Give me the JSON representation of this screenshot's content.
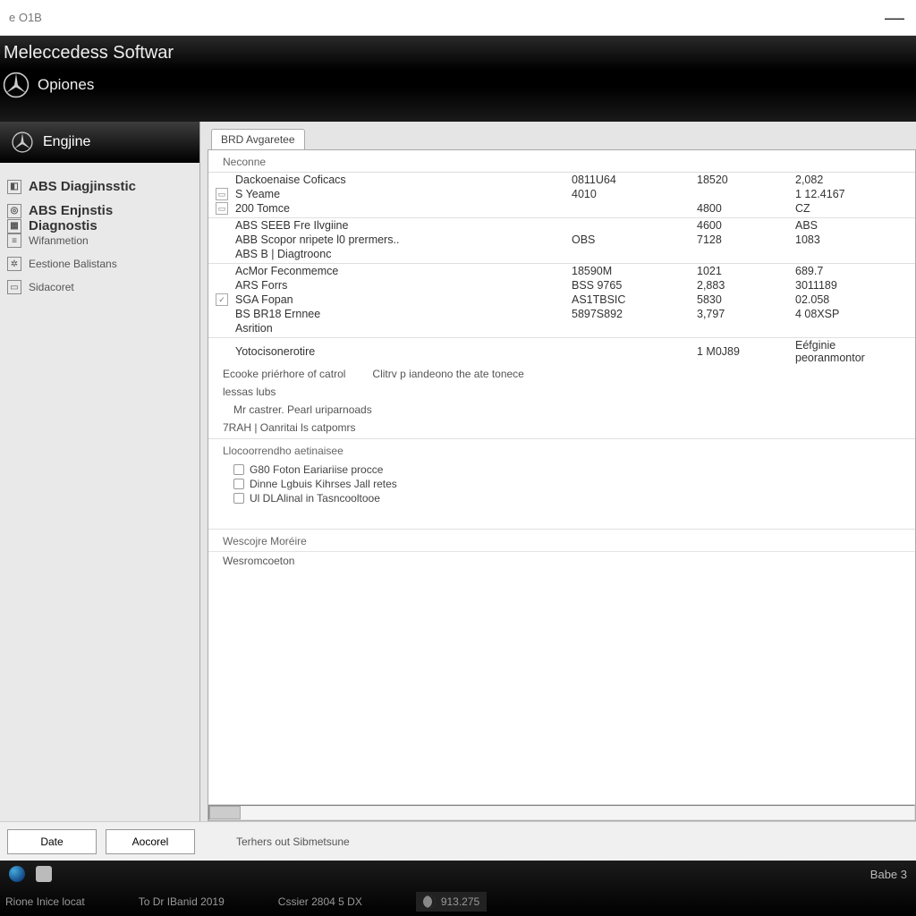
{
  "window": {
    "title_fragment": "e O1B"
  },
  "header": {
    "app_title": "Meleccedess Softwar",
    "menu_label": "Opiones"
  },
  "sidebar": {
    "active": "Engjine",
    "items": [
      {
        "label": "ABS Diagjinsstic",
        "bold": true
      },
      {
        "label": "ABS Enjnstis",
        "bold": true
      },
      {
        "label": "Diagnostis",
        "bold": true
      },
      {
        "label": "Wifanmetion",
        "small": true
      },
      {
        "label": "Eestione Balistans",
        "small": true
      },
      {
        "label": "Sidacoret",
        "small": true
      }
    ]
  },
  "content": {
    "tab_label": "BRD Avgaretee",
    "group1": {
      "header": "Neconne",
      "rows": [
        {
          "name": "Dackoenaise Coficacs",
          "c1": "0811U64",
          "c2": "18520",
          "c3": "2,082"
        },
        {
          "name": "S Yeame",
          "icon": true,
          "c1": "4010",
          "c2": "",
          "c3": "1 12.4167"
        },
        {
          "name": "200 Tomce",
          "icon": true,
          "c1": "",
          "c2": "4800",
          "c3": "CZ"
        }
      ]
    },
    "group2": {
      "rows": [
        {
          "name": "ABS SEEB Fre Ilvgiine",
          "c1": "",
          "c2": "4600",
          "c3": "ABS"
        },
        {
          "name": "ABB Scopor nripete l0 prermers..",
          "c1": "OBS",
          "c2": "7128",
          "c3": "1083"
        },
        {
          "name": "ABS B    | Diagtroonc",
          "c1": "",
          "c2": "",
          "c3": ""
        }
      ]
    },
    "group3": {
      "rows": [
        {
          "name": "AcMor Feconmemce",
          "c1": "18590M",
          "c2": "1021",
          "c3": "689.7"
        },
        {
          "name": "ARS Forrs",
          "c1": "BSS 9765",
          "c2": "2,883",
          "c3": "3011189"
        },
        {
          "name": "SGA Fopan",
          "icon": true,
          "c1": "AS1TBSIC",
          "c2": "5830",
          "c3": "02.058"
        },
        {
          "name": "BS BR18 Ernnee",
          "c1": "5897S892",
          "c2": "3,797",
          "c3": "4 08XSP"
        },
        {
          "name": "Asrition",
          "c1": "",
          "c2": "",
          "c3": ""
        }
      ]
    },
    "group4": {
      "rows": [
        {
          "name": "Yotocisonerotire",
          "c1": "",
          "c2": "1 M0J89",
          "c3": "Eéfginie peoranmontor"
        }
      ],
      "notes": [
        {
          "a": "Ecooke priérhore of catrol",
          "b": "Clitrv p iandeono the ate tonece"
        },
        {
          "a": "lessas lubs",
          "b": ""
        },
        {
          "a": "Mr castrer. Pearl uriparnoads",
          "b": ""
        }
      ],
      "header2": "7RAH    | Oanritai ls catpomrs"
    },
    "group5": {
      "header": "Llocoorrendho aetinaisee",
      "items": [
        "G80 Foton Eariariise procce",
        "Dinne Lgbuis Kihrses Jall retes",
        "Ul DLAlinal in Tasncooltooe"
      ]
    },
    "group6": {
      "header": "Wescojre Moréire",
      "row": "Wesromcoeton"
    }
  },
  "actions": {
    "btn1": "Date",
    "btn2": "Aocorel",
    "status": "Terhers out Sibmetsune"
  },
  "footer": {
    "right_label": "Babe 3",
    "line1": "Rione Inice locat",
    "line2": "To Dr  IBanid 2019",
    "line3": "Cssier 2804 5 DX",
    "pill": "913.275"
  }
}
